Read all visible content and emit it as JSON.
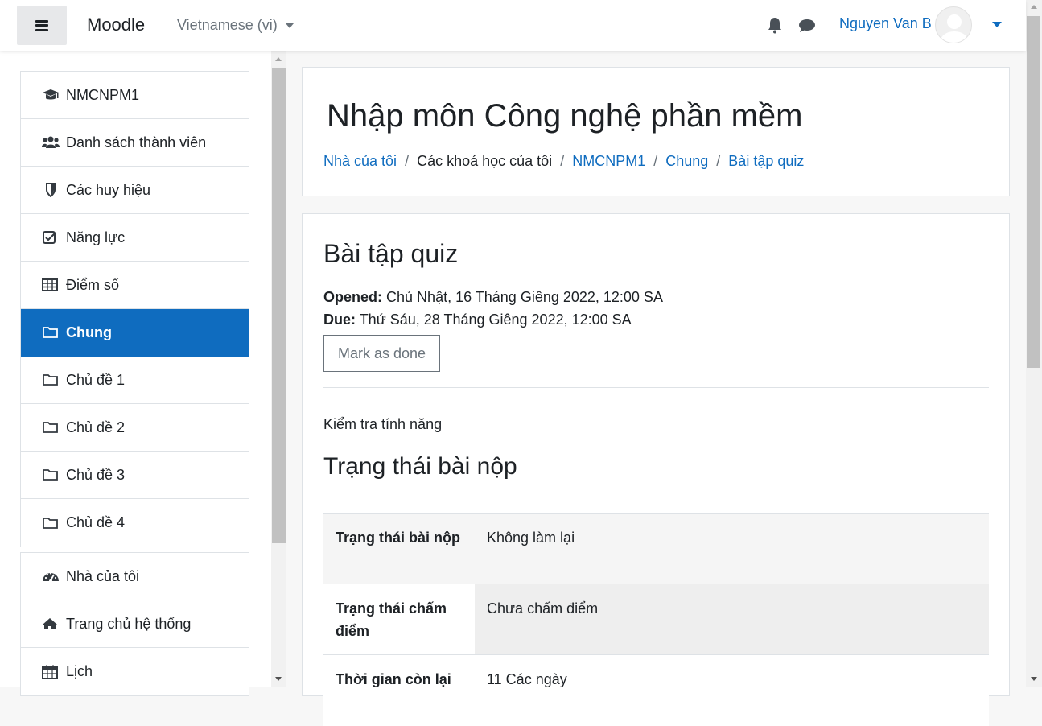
{
  "navbar": {
    "brand": "Moodle",
    "language": "Vietnamese (vi)",
    "username": "Nguyen Van B"
  },
  "drawer": {
    "course_items": [
      {
        "label": "NMCNPM1",
        "icon": "graduation-cap-icon"
      },
      {
        "label": "Danh sách thành viên",
        "icon": "users-icon"
      },
      {
        "label": "Các huy hiệu",
        "icon": "shield-icon"
      },
      {
        "label": "Năng lực",
        "icon": "check-square-icon"
      },
      {
        "label": "Điểm số",
        "icon": "table-icon"
      },
      {
        "label": "Chung",
        "icon": "folder-icon",
        "active": true
      },
      {
        "label": "Chủ đề 1",
        "icon": "folder-icon"
      },
      {
        "label": "Chủ đề 2",
        "icon": "folder-icon"
      },
      {
        "label": "Chủ đề 3",
        "icon": "folder-icon"
      },
      {
        "label": "Chủ đề 4",
        "icon": "folder-icon"
      }
    ],
    "site_items": [
      {
        "label": "Nhà của tôi",
        "icon": "dashboard-icon"
      },
      {
        "label": "Trang chủ hệ thống",
        "icon": "home-icon"
      },
      {
        "label": "Lịch",
        "icon": "calendar-icon"
      }
    ]
  },
  "header": {
    "course_title": "Nhập môn Công nghệ phần mềm",
    "breadcrumb": [
      "Nhà của tôi",
      "Các khoá học của tôi",
      "NMCNPM1",
      "Chung",
      "Bài tập quiz"
    ]
  },
  "activity": {
    "title": "Bài tập quiz",
    "opened_label": "Opened:",
    "opened_value": "Chủ Nhật, 16 Tháng Giêng 2022, 12:00 SA",
    "due_label": "Due:",
    "due_value": "Thứ Sáu, 28 Tháng Giêng 2022, 12:00 SA",
    "mark_done": "Mark as done",
    "intro": "Kiểm tra tính năng",
    "status_heading": "Trạng thái bài nộp",
    "status_rows": [
      {
        "label": "Trạng thái bài nộp",
        "value": "Không làm lại"
      },
      {
        "label": "Trạng thái chấm điểm",
        "value": "Chưa chấm điểm"
      },
      {
        "label": "Thời gian còn lại",
        "value": "11 Các ngày"
      }
    ]
  },
  "colors": {
    "accent": "#0f6cbf",
    "text": "#1d2125",
    "muted": "#6a737b"
  }
}
